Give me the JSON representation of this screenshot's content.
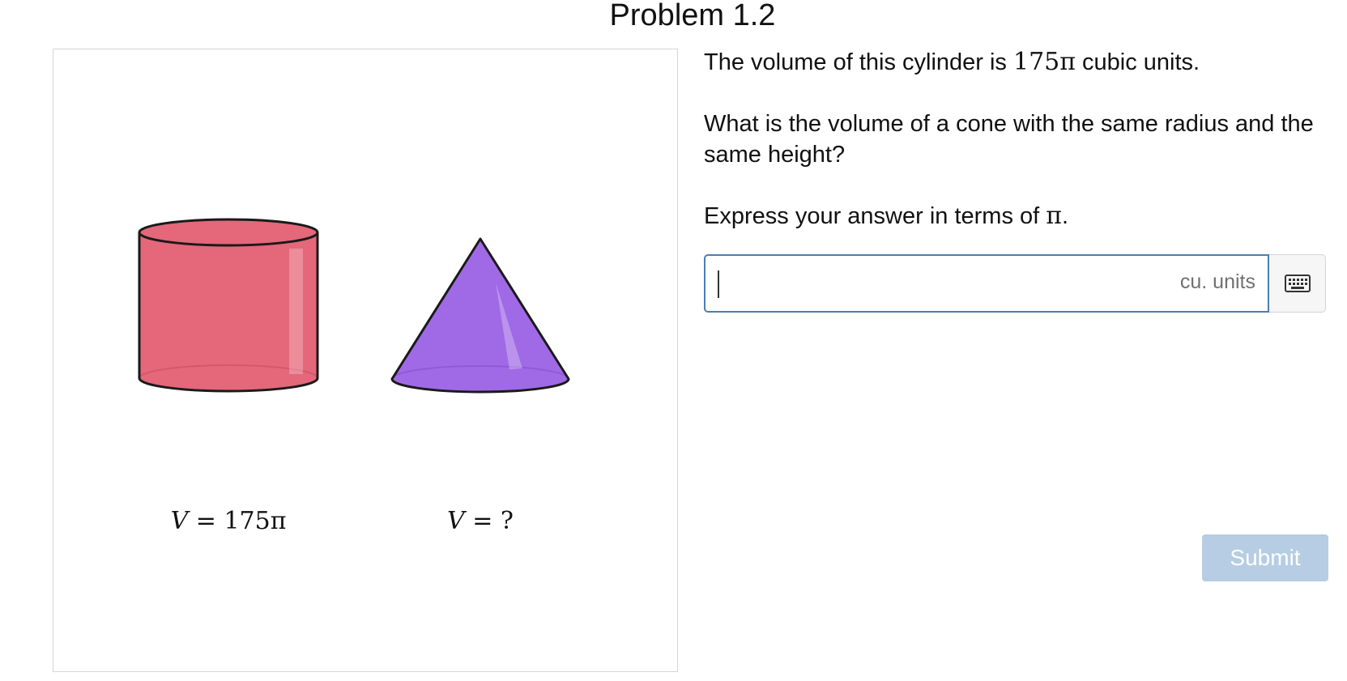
{
  "problem": {
    "title": "Problem 1.2"
  },
  "figure": {
    "cylinder_label_var": "V",
    "cylinder_label_expr": " = 175π",
    "cone_label_var": "V",
    "cone_label_expr": " = ?",
    "colors": {
      "cylinder_fill": "#e4677a",
      "cone_fill": "#a06ae6",
      "outline": "#1a1a1a"
    }
  },
  "question": {
    "line1_pre": "The volume of this cylinder is ",
    "line1_math": "175π",
    "line1_post": " cubic units.",
    "line2": "What is the volume of a cone with the same radius and the same height?",
    "line3_pre": "Express your answer in terms of ",
    "line3_math": "π",
    "line3_post": "."
  },
  "answer": {
    "value": "",
    "unit": "cu. units",
    "keyboard_icon": "keyboard-icon",
    "field_border_color": "#4a7fb4"
  },
  "submit": {
    "label": "Submit",
    "color": "#b6cde3"
  }
}
